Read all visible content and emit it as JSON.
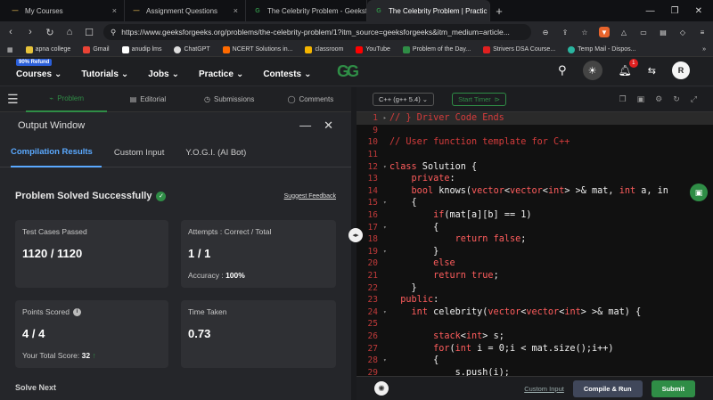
{
  "browser": {
    "tabs": [
      {
        "title": "My Courses",
        "icon": "dash-icon",
        "active": false
      },
      {
        "title": "Assignment Questions",
        "icon": "dash-icon",
        "active": false
      },
      {
        "title": "The Celebrity Problem - GeeksforGe",
        "icon": "gfg-icon",
        "active": false
      },
      {
        "title": "The Celebrity Problem | Practic",
        "icon": "gfg-icon",
        "active": true
      }
    ],
    "url": "https://www.geeksforgeeks.org/problems/the-celebrity-problem/1?itm_source=geeksforgeeks&itm_medium=article..."
  },
  "bookmarks": [
    {
      "label": "apna college",
      "color": "#e7c33a"
    },
    {
      "label": "Gmail",
      "color": "#ea4335"
    },
    {
      "label": "anudip lms",
      "color": "#ffffff"
    },
    {
      "label": "ChatGPT",
      "color": "#dddddd"
    },
    {
      "label": "NCERT Solutions in...",
      "color": "#ff6a00"
    },
    {
      "label": "classroom",
      "color": "#f4b400"
    },
    {
      "label": "YouTube",
      "color": "#ff0000"
    },
    {
      "label": "Problem of the Day...",
      "color": "#2f8d46"
    },
    {
      "label": "Strivers DSA Course...",
      "color": "#e02020"
    },
    {
      "label": "Temp Mail - Dispos...",
      "color": "#2ab5a0"
    }
  ],
  "header": {
    "refund_badge": "90% Refund",
    "menu": [
      "Courses",
      "Tutorials",
      "Jobs",
      "Practice",
      "Contests"
    ],
    "logo": "GG",
    "notif_count": "1",
    "avatar": "R"
  },
  "problem_tabs": [
    "Problem",
    "Editorial",
    "Submissions",
    "Comments"
  ],
  "output": {
    "title": "Output Window",
    "tabs": [
      "Compilation Results",
      "Custom Input",
      "Y.O.G.I. (AI Bot)"
    ],
    "status": "Problem Solved Successfully",
    "feedback": "Suggest Feedback",
    "cards": {
      "tests_label": "Test Cases Passed",
      "tests_value": "1120 / 1120",
      "attempts_label": "Attempts : Correct / Total",
      "attempts_value": "1 / 1",
      "accuracy_label": "Accuracy :",
      "accuracy_value": "100%",
      "points_label": "Points Scored",
      "points_value": "4 / 4",
      "total_label": "Your Total Score:",
      "total_value": "32",
      "time_label": "Time Taken",
      "time_value": "0.73"
    },
    "solve_next": "Solve Next"
  },
  "editor": {
    "language": "C++ (g++ 5.4)",
    "timer": "Start Timer",
    "custom_input": "Custom Input",
    "compile_run": "Compile & Run",
    "submit": "Submit",
    "lines": [
      {
        "n": "1",
        "code": "// } Driver Code Ends"
      },
      {
        "n": "9",
        "code": ""
      },
      {
        "n": "10",
        "code": "// User function template for C++"
      },
      {
        "n": "11",
        "code": ""
      },
      {
        "n": "12",
        "code": "class Solution {"
      },
      {
        "n": "13",
        "code": "    private:"
      },
      {
        "n": "14",
        "code": "    bool knows(vector<vector<int> >& mat, int a, in"
      },
      {
        "n": "15",
        "code": "    {"
      },
      {
        "n": "16",
        "code": "        if(mat[a][b] == 1)"
      },
      {
        "n": "17",
        "code": "        {"
      },
      {
        "n": "18",
        "code": "            return false;"
      },
      {
        "n": "19",
        "code": "        }"
      },
      {
        "n": "20",
        "code": "        else"
      },
      {
        "n": "21",
        "code": "        return true;"
      },
      {
        "n": "22",
        "code": "    }"
      },
      {
        "n": "23",
        "code": "  public:"
      },
      {
        "n": "24",
        "code": "    int celebrity(vector<vector<int> >& mat) {"
      },
      {
        "n": "25",
        "code": ""
      },
      {
        "n": "26",
        "code": "        stack<int> s;"
      },
      {
        "n": "27",
        "code": "        for(int i = 0;i < mat.size();i++)"
      },
      {
        "n": "28",
        "code": "        {"
      },
      {
        "n": "29",
        "code": "            s.push(i);"
      }
    ]
  }
}
